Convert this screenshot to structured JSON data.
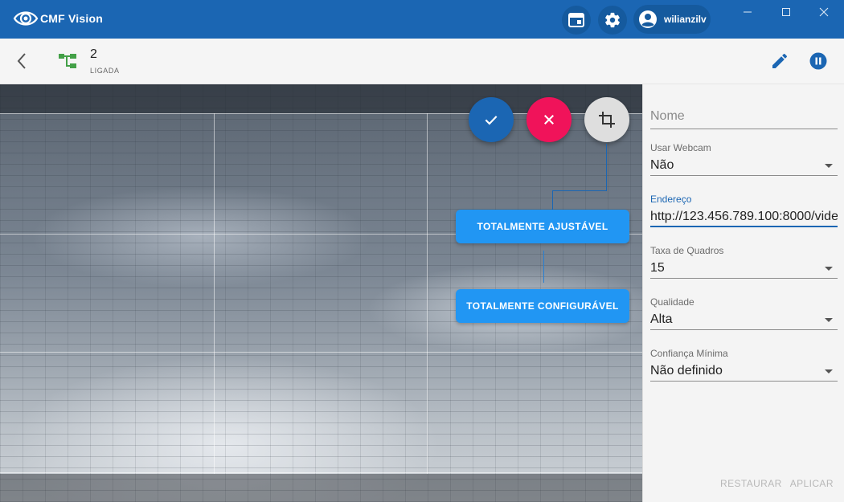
{
  "app": {
    "name": "CMF Vision"
  },
  "titlebar": {
    "layout_icon": "layout-icon",
    "settings_icon": "gear-icon",
    "user_icon": "account-circle-icon",
    "user_name": "wilianzilv",
    "window_controls": [
      "minimize-icon",
      "maximize-icon",
      "close-icon"
    ]
  },
  "toolbar": {
    "back_icon": "chevron-left-icon",
    "device_icon": "tree-structure-icon",
    "camera_title": "2",
    "camera_status": "LIGADA",
    "edit_icon": "pencil-icon",
    "pause_icon": "pause-icon"
  },
  "video": {
    "fab_confirm_icon": "check-icon",
    "fab_cancel_icon": "close-icon",
    "fab_crop_icon": "crop-icon",
    "tooltip_adjustable": "TOTALMENTE AJUSTÁVEL",
    "tooltip_configurable": "TOTALMENTE CONFIGURÁVEL"
  },
  "form": {
    "name_placeholder": "Nome",
    "webcam_label": "Usar Webcam",
    "webcam_value": "Não",
    "address_label": "Endereço",
    "address_value": "http://123.456.789.100:8000/vide",
    "fps_label": "Taxa de Quadros",
    "fps_value": "15",
    "quality_label": "Qualidade",
    "quality_value": "Alta",
    "confidence_label": "Confiança Mínima",
    "confidence_value": "Não definido",
    "reset_label": "RESTAURAR",
    "apply_label": "APLICAR"
  },
  "colors": {
    "primary": "#1b66b3",
    "accent_pink": "#f0135a",
    "tooltip_blue": "#2196f3",
    "status_green": "#43a047"
  }
}
